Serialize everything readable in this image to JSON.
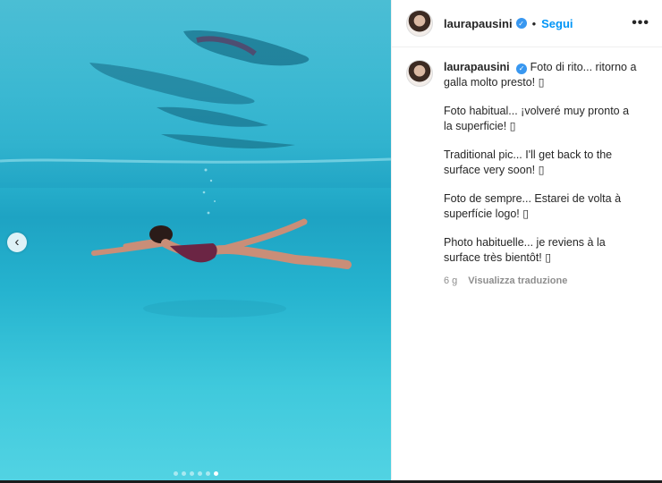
{
  "header": {
    "username": "laurapausini",
    "separator": "•",
    "follow_label": "Segui",
    "more_label": "•••"
  },
  "caption": {
    "username": "laurapausini",
    "lines": [
      "Foto di rito... ritorno a galla molto presto! ▯",
      "Foto habitual... ¡volveré muy pronto a la superficie! ▯",
      "Traditional pic... I'll get back to the surface very soon! ▯",
      "Foto de sempre... Estarei de volta à superfície logo! ▯",
      "Photo habituelle... je reviens à la surface très bientôt! ▯"
    ],
    "time": "6 g",
    "translate_label": "Visualizza traduzione"
  },
  "carousel": {
    "prev_label": "‹",
    "dot_count": 6,
    "active_index": 5
  },
  "colors": {
    "accent": "#0095f6",
    "verified": "#3897f0",
    "water": "#2bb6d2"
  }
}
